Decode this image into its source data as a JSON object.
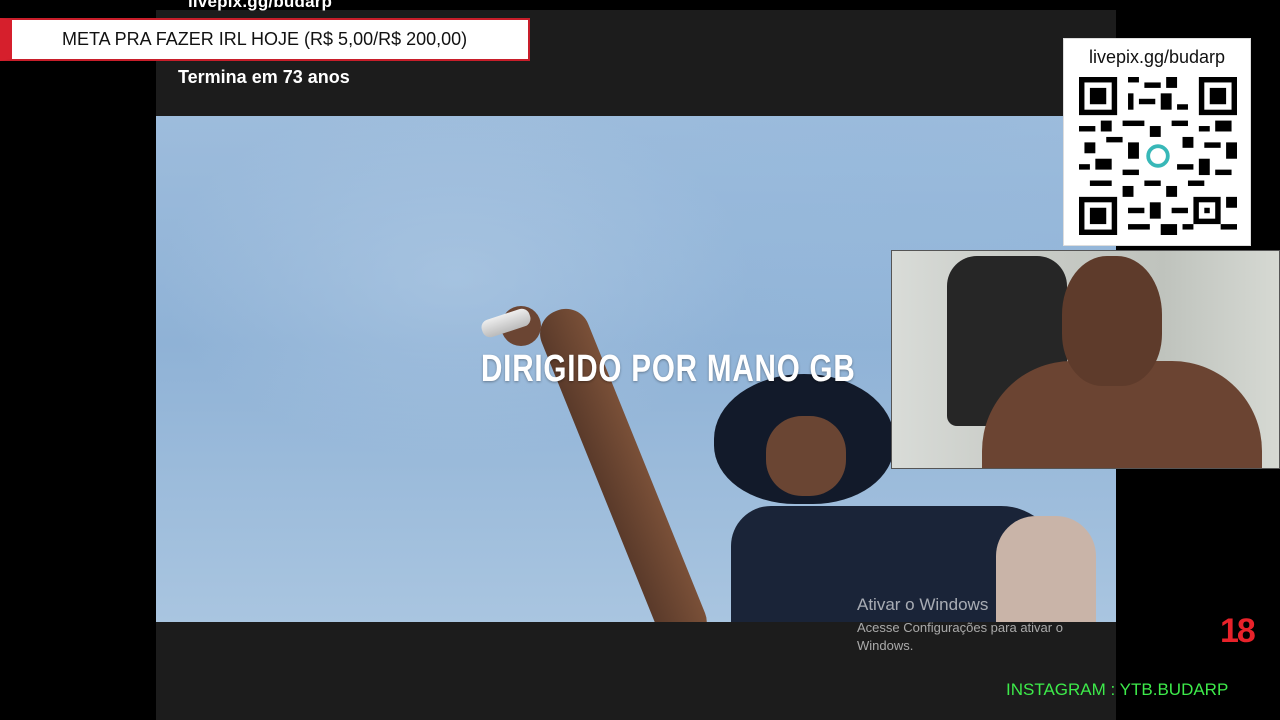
{
  "overlay": {
    "top_url": "livepix.gg/budarp",
    "goal_text": "META PRA FAZER IRL HOJE (R$ 5,00/R$ 200,00)",
    "goal_progress": 0.025,
    "countdown": "Termina em 73 anos",
    "qr_label": "livepix.gg/budarp",
    "age_rating": "18",
    "instagram": "INSTAGRAM : YTB.BUDARP"
  },
  "video": {
    "credit_text": "DIRIGIDO POR MANO GB"
  },
  "windows_watermark": {
    "title": "Ativar o Windows",
    "subtitle": "Acesse Configurações para ativar o Windows."
  },
  "colors": {
    "goal_accent": "#d61f2c",
    "age_badge": "#e8222a",
    "instagram_text": "#3dea4a"
  }
}
